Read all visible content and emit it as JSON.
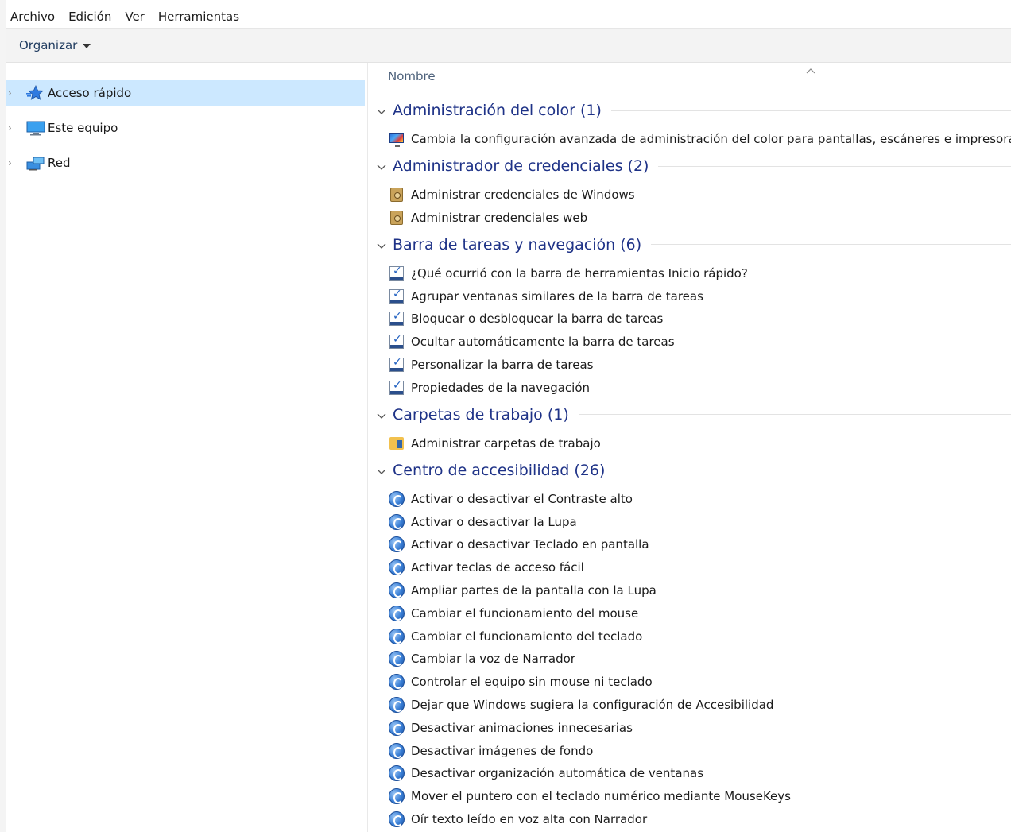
{
  "menu": [
    "Archivo",
    "Edición",
    "Ver",
    "Herramientas"
  ],
  "toolbar": {
    "organize_label": "Organizar"
  },
  "nav": [
    {
      "label": "Acceso rápido",
      "icon": "quick-access-star-icon",
      "selected": true
    },
    {
      "label": "Este equipo",
      "icon": "computer-icon",
      "selected": false
    },
    {
      "label": "Red",
      "icon": "network-icon",
      "selected": false
    }
  ],
  "content": {
    "column_header": "Nombre",
    "groups": [
      {
        "title": "Administración del color (1)",
        "icon": "color-management-icon",
        "items": [
          "Cambia la configuración avanzada de administración del color para pantallas, escáneres e impresoras"
        ]
      },
      {
        "title": "Administrador de credenciales (2)",
        "icon": "credential-vault-icon",
        "items": [
          "Administrar credenciales de Windows",
          "Administrar credenciales web"
        ]
      },
      {
        "title": "Barra de tareas y navegación (6)",
        "icon": "taskbar-icon",
        "items": [
          "¿Qué ocurrió con la barra de herramientas Inicio rápido?",
          "Agrupar ventanas similares de la barra de tareas",
          "Bloquear o desbloquear la barra de tareas",
          "Ocultar automáticamente la barra de tareas",
          "Personalizar la barra de tareas",
          "Propiedades de la navegación"
        ]
      },
      {
        "title": "Carpetas de trabajo (1)",
        "icon": "work-folders-icon",
        "items": [
          "Administrar carpetas de trabajo"
        ]
      },
      {
        "title": "Centro de accesibilidad (26)",
        "icon": "accessibility-icon",
        "items": [
          "Activar o desactivar el Contraste alto",
          "Activar o desactivar la Lupa",
          "Activar o desactivar Teclado en pantalla",
          "Activar teclas de acceso fácil",
          "Ampliar partes de la pantalla con la Lupa",
          "Cambiar el funcionamiento del mouse",
          "Cambiar el funcionamiento del teclado",
          "Cambiar la voz de Narrador",
          "Controlar el equipo sin mouse ni teclado",
          "Dejar que Windows sugiera la configuración de Accesibilidad",
          "Desactivar animaciones innecesarias",
          "Desactivar imágenes de fondo",
          "Desactivar organización automática de ventanas",
          "Mover el puntero con el teclado numérico mediante MouseKeys",
          "Oír texto leído en voz alta con Narrador"
        ]
      }
    ]
  }
}
